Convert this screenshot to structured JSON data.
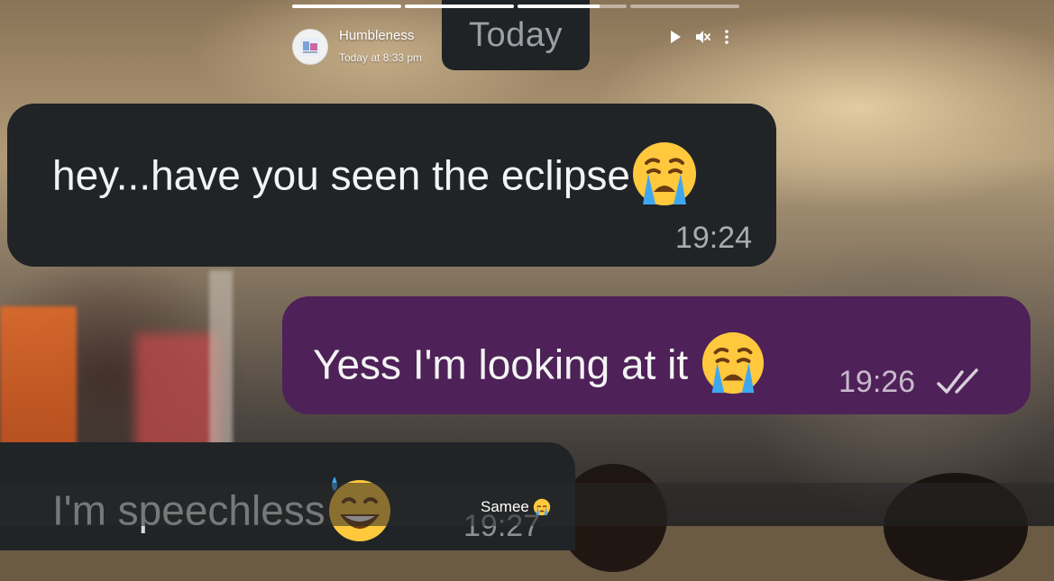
{
  "story": {
    "progress": [
      1,
      1,
      0.75,
      0
    ],
    "sender": {
      "name": "Humbleness",
      "time": "Today at 8:33 pm",
      "avatar_icon": "profile-picture"
    },
    "controls": {
      "play_icon": "play-icon",
      "mute_icon": "muted-speaker-icon",
      "menu_icon": "more-vertical-icon"
    },
    "caption": {
      "text": "Samee",
      "emoji": "crying-face"
    }
  },
  "chat_screenshot": {
    "date_chip": "Today",
    "messages": [
      {
        "direction": "incoming",
        "text": "hey...have you seen the eclipse",
        "emoji": "crying-face",
        "time": "19:24"
      },
      {
        "direction": "outgoing",
        "text": "Yess I'm looking at it",
        "emoji": "crying-face",
        "time": "19:26",
        "status": "read-double-tick"
      },
      {
        "direction": "incoming",
        "text": "I'm speechless",
        "emoji": "grinning-sweat-face",
        "time": "19:27"
      }
    ]
  },
  "colors": {
    "incoming_bubble": "#202427",
    "outgoing_bubble": "#4e2158",
    "progress_active": "#ffffff",
    "caption_bar": "rgba(40,40,40,0.55)"
  }
}
